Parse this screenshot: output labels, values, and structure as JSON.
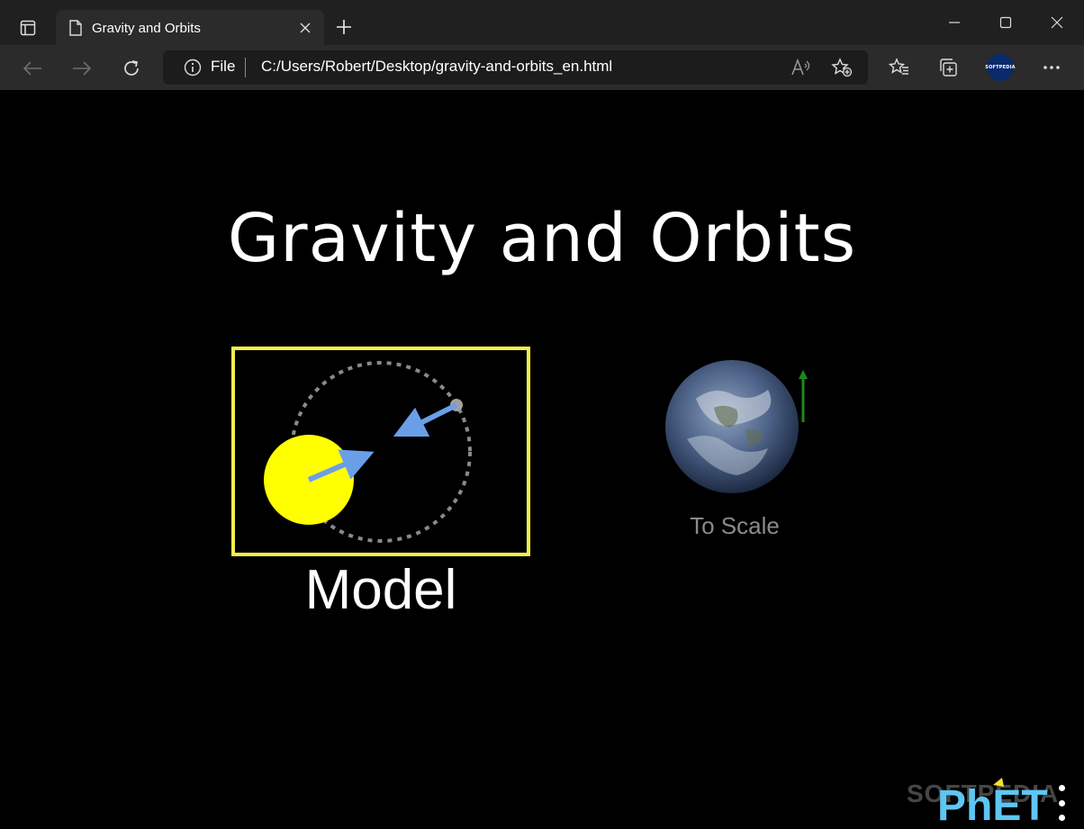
{
  "browser": {
    "tab_title": "Gravity and Orbits",
    "address_scheme_label": "File",
    "address_url": "C:/Users/Robert/Desktop/gravity-and-orbits_en.html",
    "profile_badge": "SOFTPEDIA"
  },
  "sim": {
    "title": "Gravity and Orbits",
    "screens": [
      {
        "label": "Model",
        "selected": true
      },
      {
        "label": "To Scale",
        "selected": false
      }
    ],
    "logo_text": "PhET",
    "watermark": "SOFTPEDIA"
  },
  "colors": {
    "chrome_bg": "#202020",
    "toolbar_bg": "#2b2b2b",
    "page_bg": "#000000",
    "selection_border": "#f5f04a",
    "sun": "#ffff00",
    "force_arrow": "#6a9fe8",
    "orbit_path": "#8a8a8a",
    "velocity_arrow": "#1a8a1a",
    "phet_blue": "#5ec6f2",
    "phet_yellow": "#f5e02a"
  }
}
